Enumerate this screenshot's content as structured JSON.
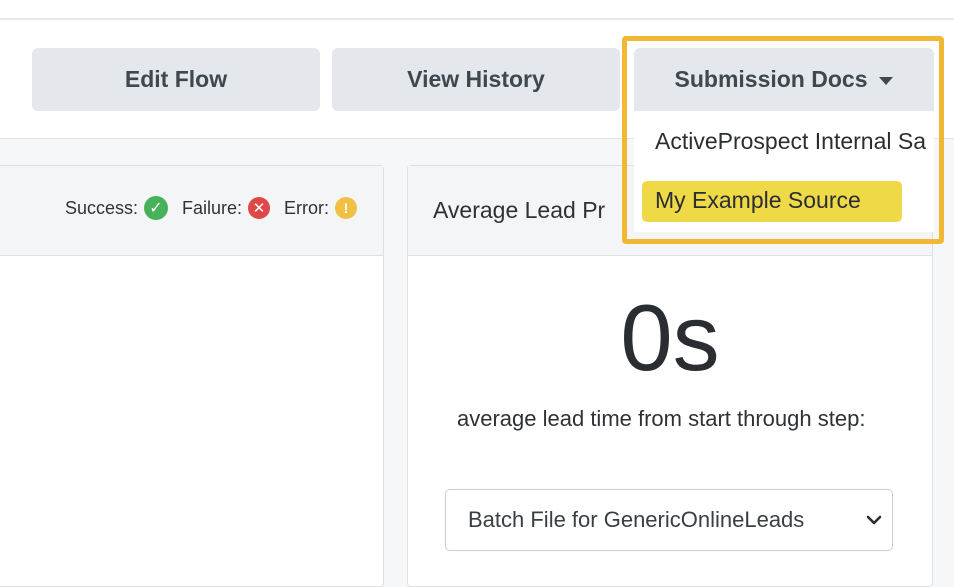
{
  "toolbar": {
    "edit_flow_label": "Edit Flow",
    "view_history_label": "View History",
    "submission_docs_label": "Submission Docs"
  },
  "submission_docs_menu": {
    "items": [
      {
        "label": "ActiveProspect Internal Sa"
      },
      {
        "label": "My Example Source",
        "highlighted": true
      }
    ],
    "highlight_color": "#efd947",
    "frame_color": "#f0b833"
  },
  "status_legend": {
    "success_label": "Success:",
    "failure_label": "Failure:",
    "error_label": "Error:",
    "success_icon": "check-circle-icon",
    "failure_icon": "x-circle-icon",
    "error_icon": "exclamation-circle-icon",
    "success_color": "#48b25a",
    "failure_color": "#e04747",
    "error_color": "#f2bf45"
  },
  "average_lead_card": {
    "title": "Average Lead Pr",
    "metric_value": "0s",
    "description": "average lead time from start through step:",
    "step_select": {
      "selected_value": "Batch File for GenericOnlineLeads"
    }
  }
}
